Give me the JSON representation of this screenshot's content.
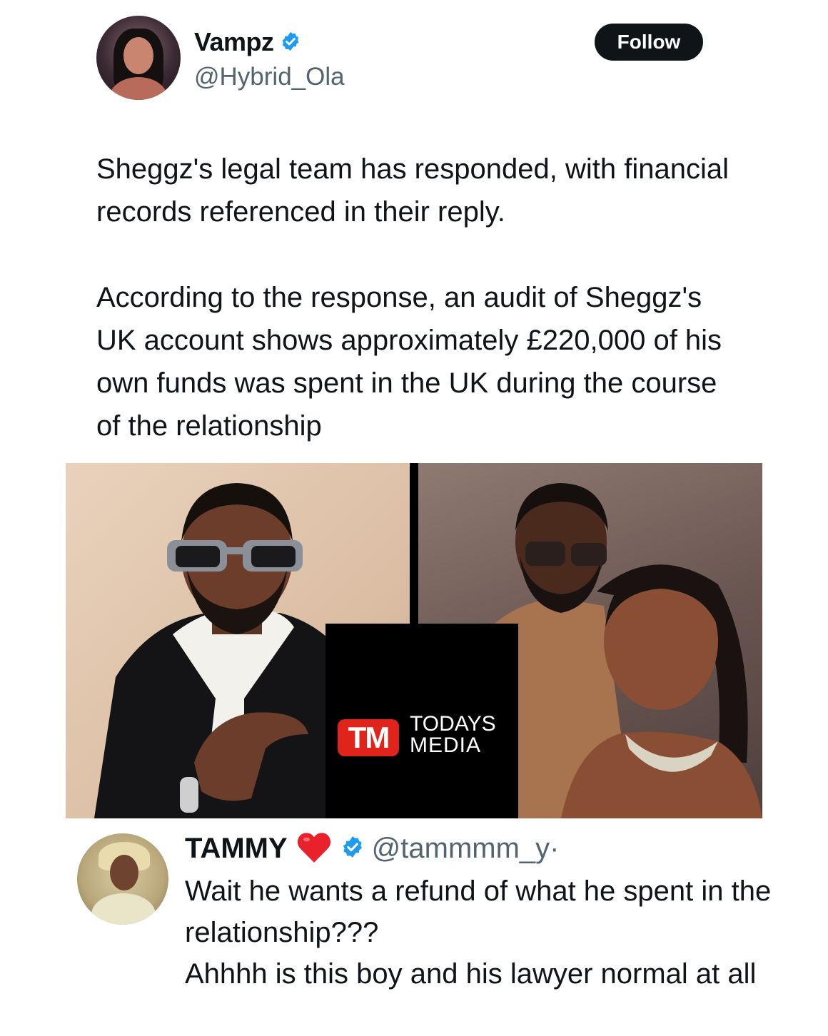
{
  "tweet": {
    "author": {
      "display_name": "Vampz",
      "handle": "@Hybrid_Ola",
      "verified": true
    },
    "follow_label": "Follow",
    "paragraphs": [
      "Sheggz's legal team has responded, with financial records referenced in their reply.",
      "According to the response, an audit of Sheggz's UK account shows approximately £220,000 of his own funds was spent in the UK during the course of the relationship"
    ],
    "media": {
      "logo_mark": "TM",
      "logo_line1": "TODAYS",
      "logo_line2": "MEDIA"
    }
  },
  "reply": {
    "display_name": "TAMMY",
    "handle": "@tammmm_y",
    "separator": "·",
    "verified": true,
    "lines": [
      "Wait he wants a refund of what he spent in the relationship???",
      "Ahhhh is this boy and his lawyer normal at all"
    ]
  },
  "colors": {
    "verified_blue": "#1d9bf0",
    "follow_bg": "#0f1419",
    "text_primary": "#0f1419",
    "text_secondary": "#536471",
    "logo_red": "#e0241b",
    "heart_red": "#e8212b"
  },
  "icons": [
    "verified-badge-icon",
    "red-heart-icon"
  ]
}
